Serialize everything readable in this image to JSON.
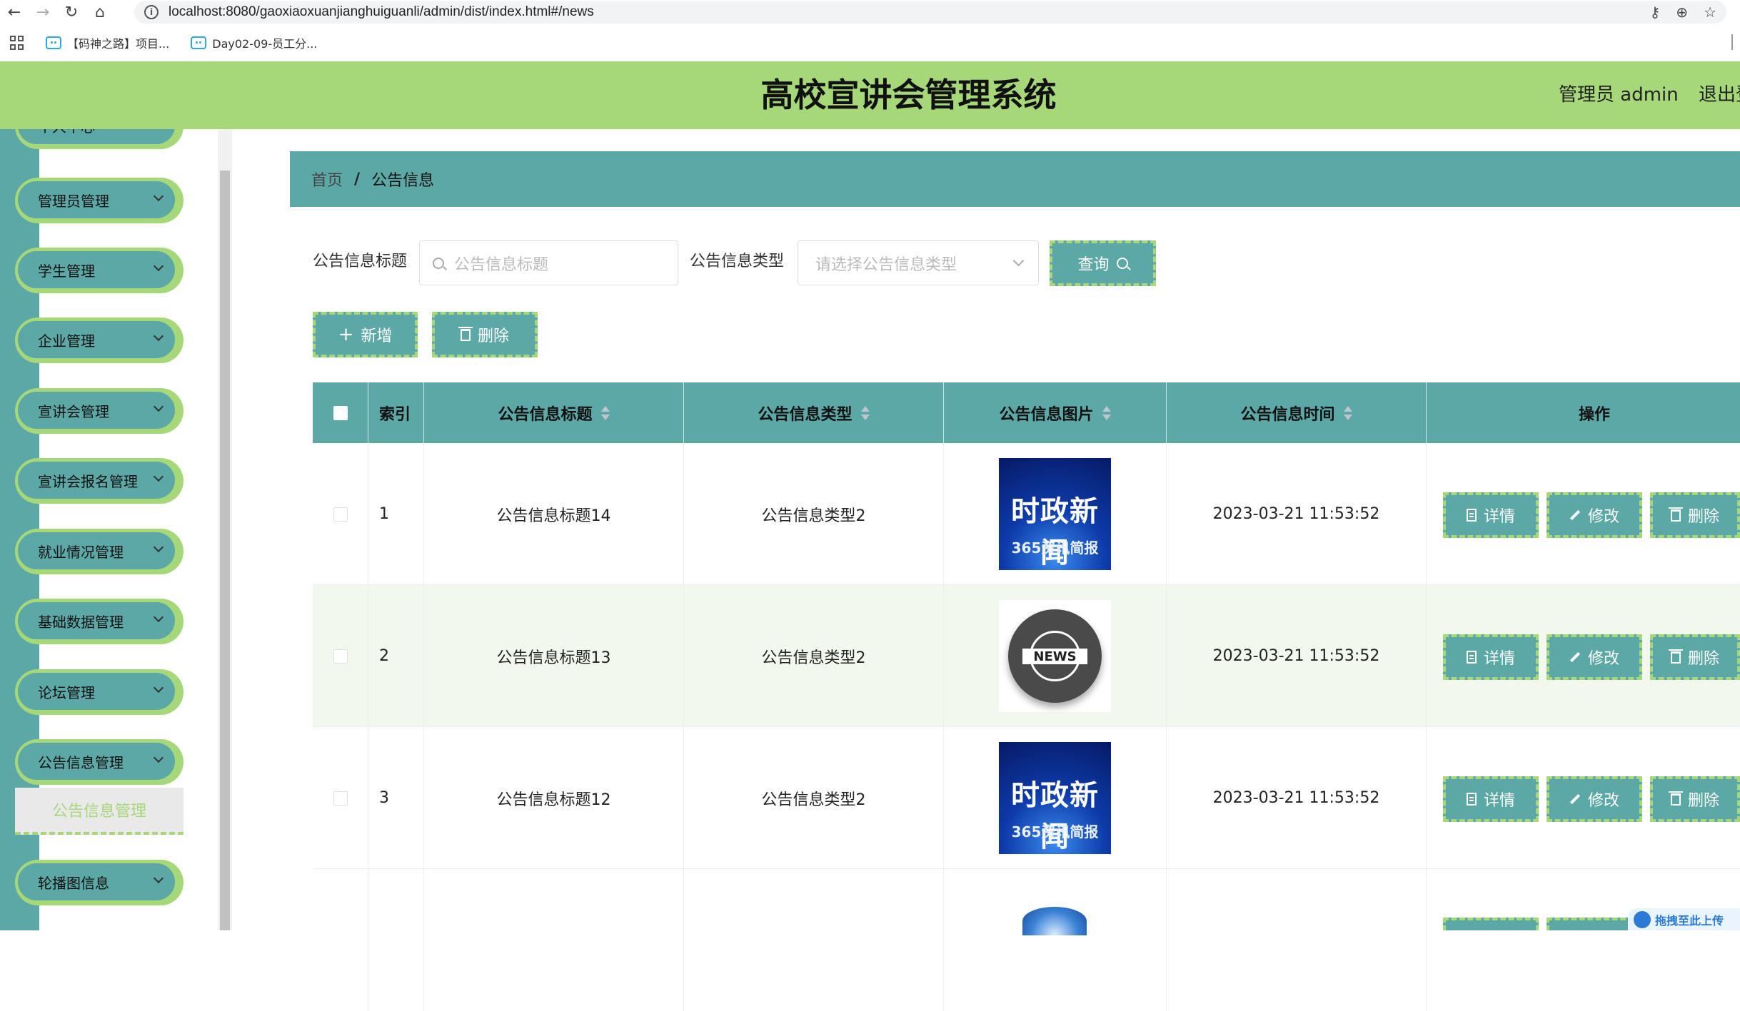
{
  "browser": {
    "url": "localhost:8080/gaoxiaoxuanjianghuiguanli/admin/dist/index.html#/news",
    "bookmarks": [
      "【码神之路】项目...",
      "Day02-09-员工分..."
    ]
  },
  "header": {
    "title": "高校宣讲会管理系统",
    "user": "管理员 admin",
    "logout": "退出登录"
  },
  "sidebar": {
    "items": [
      {
        "label": "个人中心"
      },
      {
        "label": "管理员管理"
      },
      {
        "label": "学生管理"
      },
      {
        "label": "企业管理"
      },
      {
        "label": "宣讲会管理"
      },
      {
        "label": "宣讲会报名管理"
      },
      {
        "label": "就业情况管理"
      },
      {
        "label": "基础数据管理"
      },
      {
        "label": "论坛管理"
      },
      {
        "label": "公告信息管理"
      },
      {
        "label": "轮播图信息"
      }
    ],
    "active_sub": "公告信息管理"
  },
  "breadcrumb": {
    "home": "首页",
    "sep": "/",
    "current": "公告信息"
  },
  "search": {
    "title_label": "公告信息标题",
    "title_placeholder": "公告信息标题",
    "type_label": "公告信息类型",
    "type_placeholder": "请选择公告信息类型",
    "query_button": "查询"
  },
  "toolbar": {
    "add_label": "新增",
    "delete_label": "删除"
  },
  "table": {
    "headers": {
      "index": "索引",
      "title": "公告信息标题",
      "type": "公告信息类型",
      "image": "公告信息图片",
      "time": "公告信息时间",
      "ops": "操作"
    },
    "rows": [
      {
        "index": "1",
        "title": "公告信息标题14",
        "type": "公告信息类型2",
        "image_text_main": "时政新闻",
        "image_text_sub": "365资讯简报",
        "time": "2023-03-21 11:53:52"
      },
      {
        "index": "2",
        "title": "公告信息标题13",
        "type": "公告信息类型2",
        "image_text_main": "NEWS",
        "time": "2023-03-21 11:53:52"
      },
      {
        "index": "3",
        "title": "公告信息标题12",
        "type": "公告信息类型2",
        "image_text_main": "时政新闻",
        "image_text_sub": "365资讯简报",
        "time": "2023-03-21 11:53:52"
      }
    ],
    "op_labels": {
      "detail": "详情",
      "edit": "修改",
      "delete": "删除"
    }
  },
  "upload_badge": "拖拽至此上传",
  "colors": {
    "accent_green": "#a6d779",
    "teal": "#5ba8a6"
  }
}
